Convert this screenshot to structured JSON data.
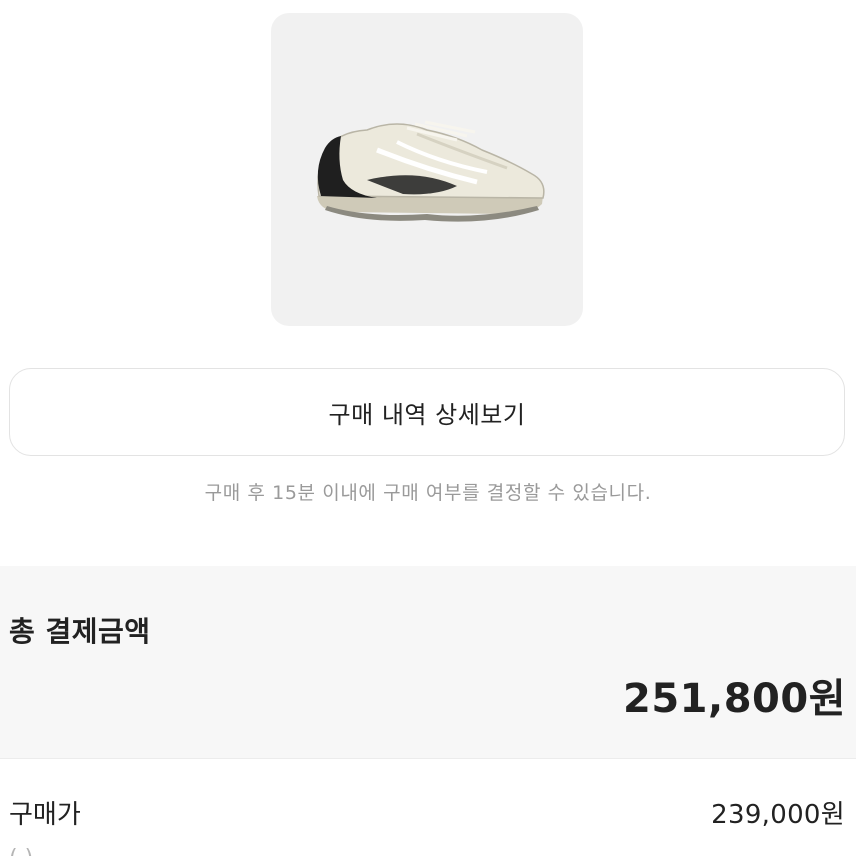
{
  "product": {
    "image_icon": "sneaker-image",
    "colors": {
      "upper": "#ece9dc",
      "accent": "#1f1f1f",
      "sole": "#cfcab8"
    }
  },
  "detail_button": {
    "label": "구매 내역 상세보기"
  },
  "notice": {
    "text": "구매 후 15분 이내에 구매 여부를 결정할 수 있습니다."
  },
  "total": {
    "label": "총 결제금액",
    "amount": "251,800원"
  },
  "breakdown": {
    "purchase_price_label": "구매가",
    "purchase_price_value": "239,000원",
    "next_label_partial": "(  )"
  }
}
